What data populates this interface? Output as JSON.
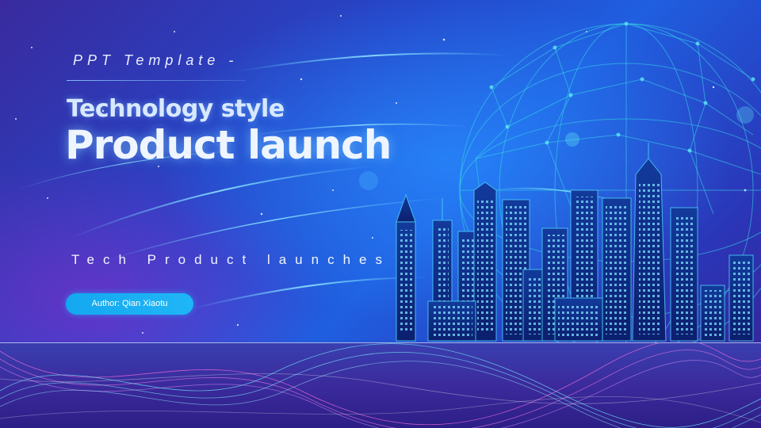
{
  "slide": {
    "template_label": "PPT Template -",
    "title_line1": "Technology style",
    "title_line2": "Product launch",
    "tagline": "Tech Product launches",
    "author_label": "Author: Qian Xiaotu"
  },
  "colors": {
    "accent": "#1fb6f6",
    "background_top": "#2546c9",
    "background_bottom": "#2c1e86",
    "glow": "#5fd0ff"
  }
}
